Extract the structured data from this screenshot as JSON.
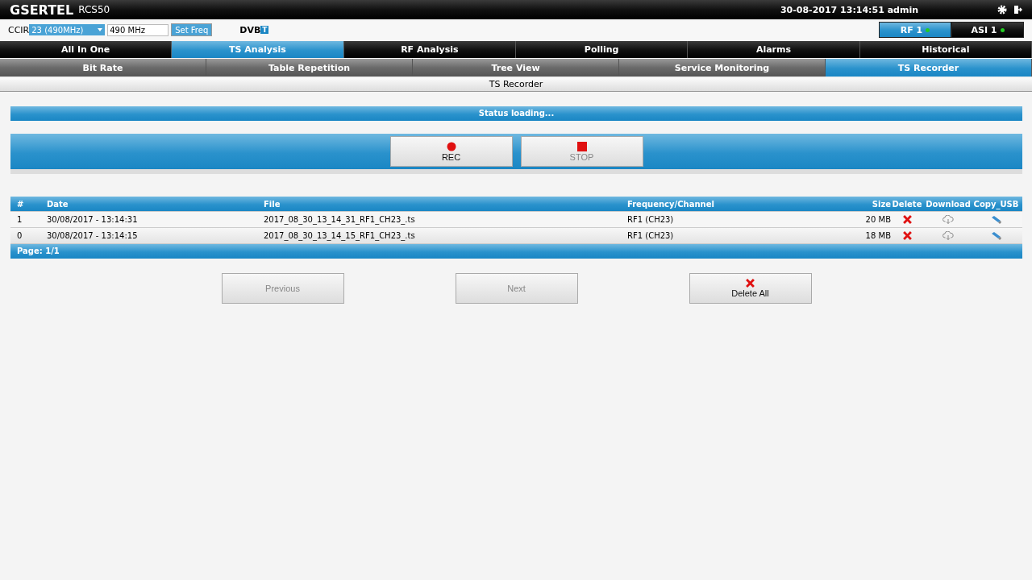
{
  "header": {
    "brand": "GSERTEL",
    "model": "RCS50",
    "datetime": "30-08-2017 13:14:51 admin"
  },
  "tuner": {
    "label": "CCIR",
    "channel": "23 (490MHz)",
    "frequency": "490 MHz",
    "button": "Set Freq",
    "logo": "DVB",
    "logo_suffix": "T"
  },
  "inputs": [
    {
      "label": "RF 1",
      "selected": true,
      "color": "#22cc22"
    },
    {
      "label": "ASI 1",
      "selected": false,
      "color": "#22cc22"
    }
  ],
  "main_tabs": [
    {
      "label": "All In One",
      "selected": false
    },
    {
      "label": "TS Analysis",
      "selected": true
    },
    {
      "label": "RF Analysis",
      "selected": false
    },
    {
      "label": "Polling",
      "selected": false
    },
    {
      "label": "Alarms",
      "selected": false
    },
    {
      "label": "Historical",
      "selected": false
    }
  ],
  "sub_tabs": [
    {
      "label": "Bit Rate",
      "selected": false
    },
    {
      "label": "Table Repetition",
      "selected": false
    },
    {
      "label": "Tree View",
      "selected": false
    },
    {
      "label": "Service Monitoring",
      "selected": false
    },
    {
      "label": "TS Recorder",
      "selected": true
    }
  ],
  "page_title": "TS Recorder",
  "status": "Status loading...",
  "record_buttons": [
    {
      "kind": "rec",
      "label": "REC",
      "disabled": false
    },
    {
      "kind": "stop",
      "label": "STOP",
      "disabled": true
    }
  ],
  "table": {
    "columns": [
      "#",
      "Date",
      "File",
      "Frequency/Channel",
      "Size",
      "Delete",
      "Download",
      "Copy_USB"
    ],
    "rows": [
      {
        "index": "1",
        "date": "30/08/2017 - 13:14:31",
        "file": "2017_08_30_13_14_31_RF1_CH23_.ts",
        "channel": "RF1 (CH23)",
        "size": "20 MB"
      },
      {
        "index": "0",
        "date": "30/08/2017 - 13:14:15",
        "file": "2017_08_30_13_14_15_RF1_CH23_.ts",
        "channel": "RF1 (CH23)",
        "size": "18 MB"
      }
    ],
    "footer": "Page: 1/1"
  },
  "pager_buttons": [
    {
      "kind": "previous",
      "label": "Previous",
      "disabled": true
    },
    {
      "kind": "next",
      "label": "Next",
      "disabled": true
    },
    {
      "kind": "delete",
      "label": "Delete All",
      "disabled": false
    }
  ]
}
